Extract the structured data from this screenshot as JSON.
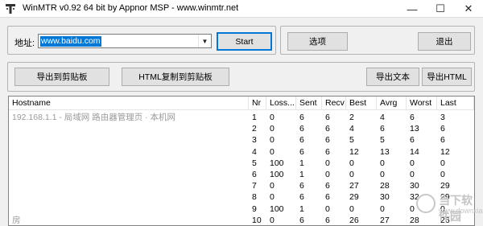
{
  "window": {
    "title": "WinMTR v0.92 64 bit by Appnor MSP - www.winmtr.net",
    "controls": [
      "—",
      "☐",
      "✕"
    ]
  },
  "host": {
    "label": "地址:",
    "value": "www.baidu.com"
  },
  "buttons": {
    "start": "Start",
    "options": "选项",
    "exit": "退出",
    "copy_text": "导出到剪贴板",
    "copy_html": "HTML复制到剪贴板",
    "export_text": "导出文本",
    "export_html": "导出HTML"
  },
  "table": {
    "columns": [
      "Hostname",
      "Nr",
      "Loss...",
      "Sent",
      "Recv",
      "Best",
      "Avrg",
      "Worst",
      "Last"
    ],
    "rows": [
      {
        "hostname": "192.168.1.1 - 局域网 路由器管理页 · 本机网",
        "nr": "1",
        "loss": "0",
        "sent": "6",
        "recv": "6",
        "best": "2",
        "avrg": "4",
        "worst": "6",
        "last": "3"
      },
      {
        "hostname": "",
        "nr": "2",
        "loss": "0",
        "sent": "6",
        "recv": "6",
        "best": "4",
        "avrg": "6",
        "worst": "13",
        "last": "6"
      },
      {
        "hostname": "",
        "nr": "3",
        "loss": "0",
        "sent": "6",
        "recv": "6",
        "best": "5",
        "avrg": "5",
        "worst": "6",
        "last": "6"
      },
      {
        "hostname": "",
        "nr": "4",
        "loss": "0",
        "sent": "6",
        "recv": "6",
        "best": "12",
        "avrg": "13",
        "worst": "14",
        "last": "12"
      },
      {
        "hostname": "",
        "nr": "5",
        "loss": "100",
        "sent": "1",
        "recv": "0",
        "best": "0",
        "avrg": "0",
        "worst": "0",
        "last": "0"
      },
      {
        "hostname": "",
        "nr": "6",
        "loss": "100",
        "sent": "1",
        "recv": "0",
        "best": "0",
        "avrg": "0",
        "worst": "0",
        "last": "0"
      },
      {
        "hostname": "",
        "nr": "7",
        "loss": "0",
        "sent": "6",
        "recv": "6",
        "best": "27",
        "avrg": "28",
        "worst": "30",
        "last": "29"
      },
      {
        "hostname": "",
        "nr": "8",
        "loss": "0",
        "sent": "6",
        "recv": "6",
        "best": "29",
        "avrg": "30",
        "worst": "32",
        "last": "29"
      },
      {
        "hostname": "",
        "nr": "9",
        "loss": "100",
        "sent": "1",
        "recv": "0",
        "best": "0",
        "avrg": "0",
        "worst": "0",
        "last": "0"
      },
      {
        "hostname": "房",
        "nr": "10",
        "loss": "0",
        "sent": "6",
        "recv": "6",
        "best": "26",
        "avrg": "27",
        "worst": "28",
        "last": "26"
      }
    ]
  },
  "watermark": {
    "line1": "当下软件园",
    "line2": "www.downxia.com"
  },
  "colors": {
    "selection": "#0078d7",
    "button_face": "#e1e1e1",
    "window_bg": "#f0f0f0"
  }
}
